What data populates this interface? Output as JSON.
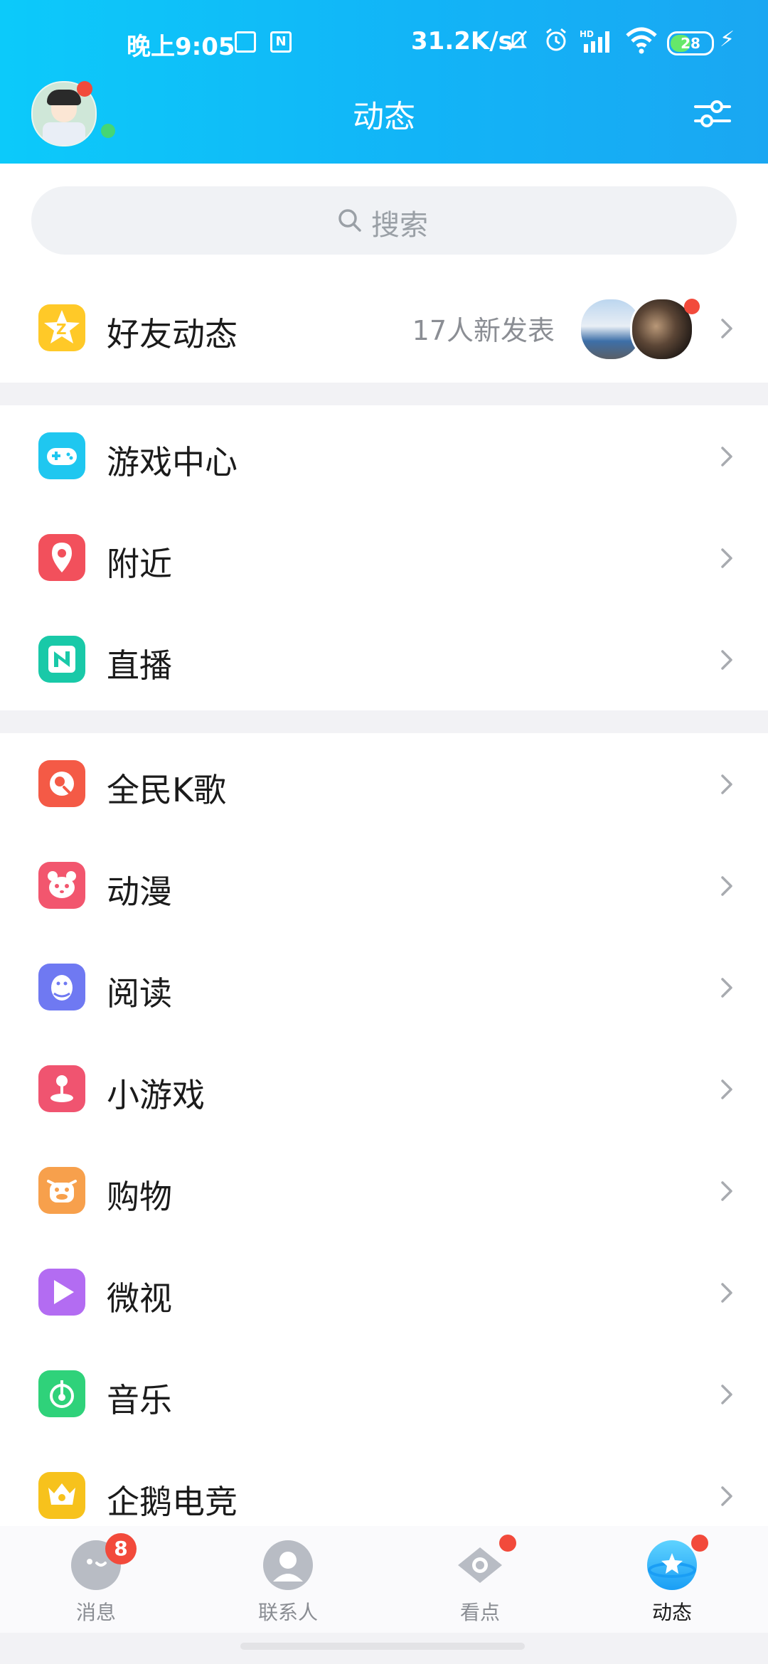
{
  "status_bar": {
    "time": "晚上9:05",
    "speed": "31.2K/s",
    "battery": "28",
    "icons": [
      "screen-record-icon",
      "n-app-icon",
      "mute-bell-icon",
      "alarm-icon",
      "hd-signal-icon",
      "wifi-icon",
      "battery-icon",
      "charging-icon"
    ]
  },
  "header": {
    "title": "动态"
  },
  "search": {
    "placeholder": "搜索"
  },
  "friends_feed": {
    "label": "好友动态",
    "new_posts": "17人新发表"
  },
  "section1": [
    {
      "label": "游戏中心",
      "icon": "game-controller-icon",
      "color": "#1fc7f0"
    },
    {
      "label": "附近",
      "icon": "location-pin-icon",
      "color": "#f2505c"
    },
    {
      "label": "直播",
      "icon": "live-n-icon",
      "color": "#19c9a8"
    }
  ],
  "section2": [
    {
      "label": "全民K歌",
      "icon": "karaoke-icon",
      "color": "#f45a46"
    },
    {
      "label": "动漫",
      "icon": "panda-icon",
      "color": "#f2566e"
    },
    {
      "label": "阅读",
      "icon": "penguin-book-icon",
      "color": "#6f79f2"
    },
    {
      "label": "小游戏",
      "icon": "joystick-icon",
      "color": "#f05470"
    },
    {
      "label": "购物",
      "icon": "cow-shopping-icon",
      "color": "#f7a04c"
    },
    {
      "label": "微视",
      "icon": "video-play-icon",
      "color": "#b36cf2"
    },
    {
      "label": "音乐",
      "icon": "music-note-icon",
      "color": "#2fd27a"
    },
    {
      "label": "企鹅电竞",
      "icon": "esports-crown-icon",
      "color": "#f7c21c"
    }
  ],
  "tabbar": {
    "messages": {
      "label": "消息",
      "badge": "8"
    },
    "contacts": {
      "label": "联系人"
    },
    "kandian": {
      "label": "看点"
    },
    "dongtai": {
      "label": "动态"
    }
  },
  "colors": {
    "header_gradient_start": "#0ccafa",
    "header_gradient_end": "#1aa7f2",
    "badge_red": "#f24a3b"
  }
}
